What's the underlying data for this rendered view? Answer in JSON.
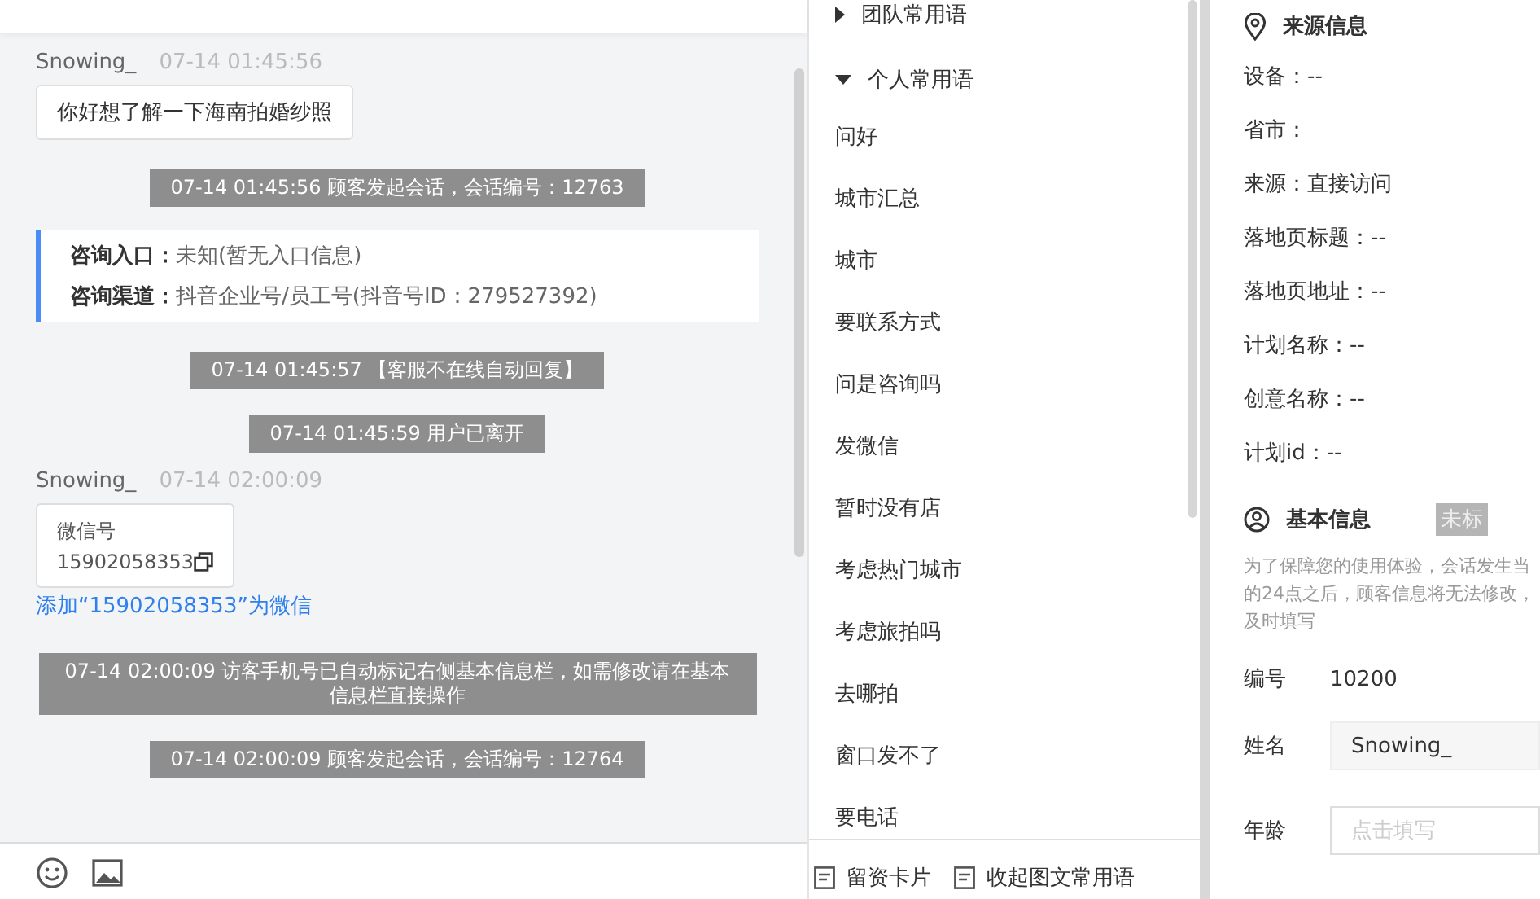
{
  "chat": {
    "messages": [
      {
        "kind": "user",
        "name": "Snowing_",
        "time": "07-14 01:45:56",
        "text": "你好想了解一下海南拍婚纱照"
      },
      {
        "kind": "system",
        "text": "07-14 01:45:56 顾客发起会话，会话编号：12763"
      },
      {
        "kind": "entry",
        "rows": [
          {
            "label": "咨询入口：",
            "value": "未知(暂无入口信息)"
          },
          {
            "label": "咨询渠道：",
            "value": "抖音企业号/员工号(抖音号ID：279527392)"
          }
        ]
      },
      {
        "kind": "system",
        "text": "07-14 01:45:57 【客服不在线自动回复】"
      },
      {
        "kind": "system",
        "text": "07-14 01:45:59 用户已离开"
      },
      {
        "kind": "wechat",
        "name": "Snowing_",
        "time": "07-14 02:00:09",
        "title": "微信号",
        "number": "15902058353",
        "link": "添加“15902058353”为微信"
      },
      {
        "kind": "system",
        "text": "07-14 02:00:09 访客手机号已自动标记右侧基本信息栏，如需修改请在基本信息栏直接操作"
      },
      {
        "kind": "system",
        "text": "07-14 02:00:09 顾客发起会话，会话编号：12764"
      }
    ]
  },
  "quick_replies": {
    "groups": [
      {
        "label": "团队常用语",
        "expanded": false
      },
      {
        "label": "个人常用语",
        "expanded": true,
        "children": [
          "问好",
          "城市汇总",
          "城市",
          "要联系方式",
          "问是咨询吗",
          "发微信",
          "暂时没有店",
          "考虑热门城市",
          "考虑旅拍吗",
          "去哪拍",
          "窗口发不了",
          "要电话"
        ]
      }
    ],
    "footer": [
      "留资卡片",
      "收起图文常用语"
    ]
  },
  "source_info": {
    "title": "来源信息",
    "rows": [
      "设备：--",
      "省市：",
      "来源：直接访问",
      "落地页标题：--",
      "落地页地址：--",
      "计划名称：--",
      "创意名称：--",
      "计划id：--"
    ]
  },
  "basic_info": {
    "title": "基本信息",
    "tag": "未标",
    "notice": [
      "为了保障您的使用体验，会话发生当",
      "的24点之后，顾客信息将无法修改，",
      "及时填写"
    ],
    "fields": [
      {
        "kind": "text",
        "label": "编号",
        "value": "10200"
      },
      {
        "kind": "input",
        "label": "姓名",
        "value": "Snowing_"
      },
      {
        "kind": "empty",
        "label": "年龄",
        "placeholder": "点击填写"
      }
    ]
  }
}
